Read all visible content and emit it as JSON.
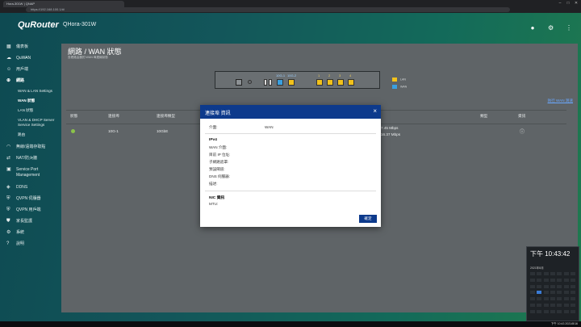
{
  "browser": {
    "tab_title": "Hora-301W | QNAP",
    "url": "https://192.168.100.1/#/"
  },
  "brand": {
    "logo": "QuRouter",
    "model": "QHora-301W"
  },
  "sidebar": {
    "items": [
      {
        "icon": "dashboard-icon",
        "label": "儀表板"
      },
      {
        "icon": "cloud-icon",
        "label": "QuWAN"
      },
      {
        "icon": "user-icon",
        "label": "用戶端"
      },
      {
        "icon": "globe-icon",
        "label": "網路"
      },
      {
        "icon": "sub",
        "label": "WAN & LAN Settings"
      },
      {
        "icon": "sub",
        "label": "WAN 狀態"
      },
      {
        "icon": "sub",
        "label": "LAN 狀態"
      },
      {
        "icon": "sub",
        "label": "VLAN & DHCP Server"
      },
      {
        "icon": "sub2",
        "label": "Service Settings"
      },
      {
        "icon": "sub",
        "label": "路由"
      },
      {
        "icon": "wifi-icon",
        "label": "無線/遠端存取點"
      },
      {
        "icon": "nat-icon",
        "label": "NAT/防火牆"
      },
      {
        "icon": "service-icon",
        "label": "Service Port"
      },
      {
        "icon": "sub2",
        "label": "Management"
      },
      {
        "icon": "ddns-icon",
        "label": "DDNS"
      },
      {
        "icon": "vpn-icon",
        "label": "QVPN 伺服器"
      },
      {
        "icon": "vpn-icon",
        "label": "QVPN 用戶端"
      },
      {
        "icon": "security-icon",
        "label": "家長監護"
      },
      {
        "icon": "system-icon",
        "label": "系統"
      },
      {
        "icon": "help-icon",
        "label": "說明"
      }
    ]
  },
  "page": {
    "title": "網路 / WAN 狀態",
    "subtitle": "查看路由器的 WAN 埠連線狀態",
    "link": "執行 WAN 測速",
    "legend": [
      {
        "label": "LAN",
        "color": "#f2c21b"
      },
      {
        "label": "WAN",
        "color": "#3aa0e0"
      }
    ],
    "ports": [
      "10G-1",
      "10G-2",
      "1",
      "2",
      "3",
      "4"
    ]
  },
  "table": {
    "headers": [
      "狀態",
      "連接埠",
      "連接埠類型",
      "",
      "",
      "",
      "",
      "類型",
      "資訊"
    ],
    "row": {
      "port": "10G-1",
      "type": "10GbE",
      "rate1": "7.45 Mbps",
      "rate2": "16.37 Mbps"
    }
  },
  "modal": {
    "title": "連接埠 資訊",
    "close": "×",
    "interface_label": "介面:",
    "interface_value": "WAN",
    "ipv4_head": "IPv4",
    "fields": [
      "WAN 介面:",
      "目前 IP 位址:",
      "子網路遮罩:",
      "預設閘道:",
      "DNS 伺服器:",
      "描述:"
    ],
    "nic_head": "NIC 資訊",
    "mtu_label": "MTU:",
    "ok": "確定"
  },
  "clock": {
    "time": "下午 10:43:42",
    "date": "2021年8月"
  },
  "taskbar": {
    "right": "下午 10:43 2021/8/16"
  }
}
